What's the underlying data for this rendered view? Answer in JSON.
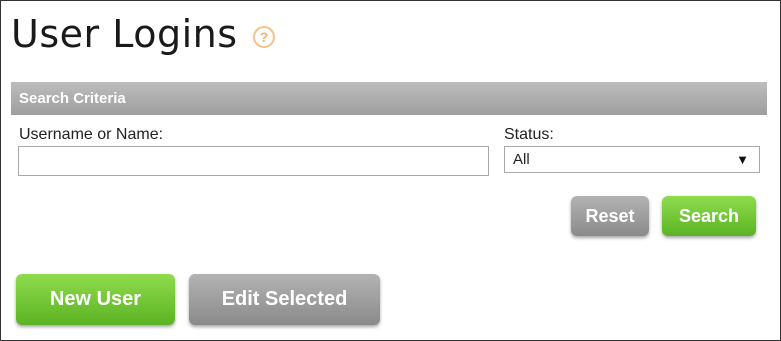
{
  "page": {
    "title": "User Logins",
    "help_icon_glyph": "?"
  },
  "search_criteria": {
    "header": "Search Criteria",
    "username_label": "Username or Name:",
    "username_value": "",
    "status_label": "Status:",
    "status_selected": "All",
    "reset_label": "Reset",
    "search_label": "Search"
  },
  "actions": {
    "new_user_label": "New User",
    "edit_selected_label": "Edit Selected"
  },
  "colors": {
    "header_bar": "#a8a8a8",
    "green_button": "#6cc22f",
    "gray_button": "#9a9a9a",
    "help_icon": "#f3b26a"
  }
}
